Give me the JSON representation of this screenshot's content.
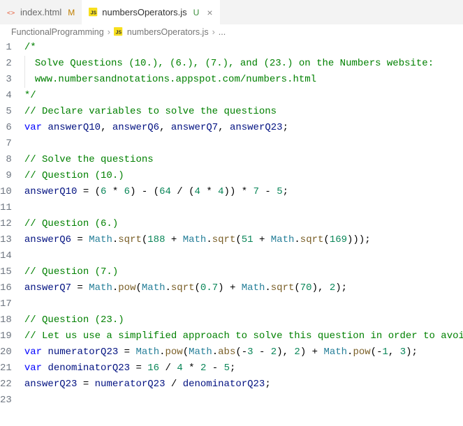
{
  "tabs": [
    {
      "label": "index.html",
      "status": "M",
      "icon": "html"
    },
    {
      "label": "numbersOperators.js",
      "status": "U",
      "icon": "js",
      "active": true
    }
  ],
  "breadcrumb": {
    "folder": "FunctionalProgramming",
    "file": "numbersOperators.js",
    "more": "..."
  },
  "code": {
    "lines": [
      {
        "n": 1,
        "segs": [
          {
            "t": "/*",
            "c": "c-comment"
          }
        ]
      },
      {
        "n": 2,
        "segs": [
          {
            "t": "    Solve Questions (10.), (6.), (7.), and (23.) on the Numbers website:",
            "c": "c-comment"
          }
        ],
        "guide": true
      },
      {
        "n": 3,
        "segs": [
          {
            "t": "    www.numbersandnotations.appspot.com/numbers.html",
            "c": "c-comment"
          }
        ],
        "guide": true
      },
      {
        "n": 4,
        "segs": [
          {
            "t": "*/",
            "c": "c-comment"
          }
        ]
      },
      {
        "n": 5,
        "segs": [
          {
            "t": "// Declare variables to solve the questions",
            "c": "c-comment"
          }
        ]
      },
      {
        "n": 6,
        "segs": [
          {
            "t": "var",
            "c": "c-keyword"
          },
          {
            "t": " "
          },
          {
            "t": "answerQ10",
            "c": "c-var"
          },
          {
            "t": ", "
          },
          {
            "t": "answerQ6",
            "c": "c-var"
          },
          {
            "t": ", "
          },
          {
            "t": "answerQ7",
            "c": "c-var"
          },
          {
            "t": ", "
          },
          {
            "t": "answerQ23",
            "c": "c-var"
          },
          {
            "t": ";"
          }
        ]
      },
      {
        "n": 7,
        "segs": []
      },
      {
        "n": 8,
        "segs": [
          {
            "t": "// Solve the questions",
            "c": "c-comment"
          }
        ]
      },
      {
        "n": 9,
        "segs": [
          {
            "t": "// Question (10.)",
            "c": "c-comment"
          }
        ]
      },
      {
        "n": 10,
        "segs": [
          {
            "t": "answerQ10",
            "c": "c-var"
          },
          {
            "t": " = ("
          },
          {
            "t": "6",
            "c": "c-num"
          },
          {
            "t": " * "
          },
          {
            "t": "6",
            "c": "c-num"
          },
          {
            "t": ") - ("
          },
          {
            "t": "64",
            "c": "c-num"
          },
          {
            "t": " / ("
          },
          {
            "t": "4",
            "c": "c-num"
          },
          {
            "t": " * "
          },
          {
            "t": "4",
            "c": "c-num"
          },
          {
            "t": ")) * "
          },
          {
            "t": "7",
            "c": "c-num"
          },
          {
            "t": " - "
          },
          {
            "t": "5",
            "c": "c-num"
          },
          {
            "t": ";"
          }
        ]
      },
      {
        "n": 11,
        "segs": []
      },
      {
        "n": 12,
        "segs": [
          {
            "t": "// Question (6.)",
            "c": "c-comment"
          }
        ]
      },
      {
        "n": 13,
        "segs": [
          {
            "t": "answerQ6",
            "c": "c-var"
          },
          {
            "t": " = "
          },
          {
            "t": "Math",
            "c": "c-obj"
          },
          {
            "t": "."
          },
          {
            "t": "sqrt",
            "c": "c-func"
          },
          {
            "t": "("
          },
          {
            "t": "188",
            "c": "c-num"
          },
          {
            "t": " + "
          },
          {
            "t": "Math",
            "c": "c-obj"
          },
          {
            "t": "."
          },
          {
            "t": "sqrt",
            "c": "c-func"
          },
          {
            "t": "("
          },
          {
            "t": "51",
            "c": "c-num"
          },
          {
            "t": " + "
          },
          {
            "t": "Math",
            "c": "c-obj"
          },
          {
            "t": "."
          },
          {
            "t": "sqrt",
            "c": "c-func"
          },
          {
            "t": "("
          },
          {
            "t": "169",
            "c": "c-num"
          },
          {
            "t": ")));"
          }
        ]
      },
      {
        "n": 14,
        "segs": []
      },
      {
        "n": 15,
        "segs": [
          {
            "t": "// Question (7.)",
            "c": "c-comment"
          }
        ]
      },
      {
        "n": 16,
        "segs": [
          {
            "t": "answerQ7",
            "c": "c-var"
          },
          {
            "t": " = "
          },
          {
            "t": "Math",
            "c": "c-obj"
          },
          {
            "t": "."
          },
          {
            "t": "pow",
            "c": "c-func"
          },
          {
            "t": "("
          },
          {
            "t": "Math",
            "c": "c-obj"
          },
          {
            "t": "."
          },
          {
            "t": "sqrt",
            "c": "c-func"
          },
          {
            "t": "("
          },
          {
            "t": "0.7",
            "c": "c-num"
          },
          {
            "t": ") + "
          },
          {
            "t": "Math",
            "c": "c-obj"
          },
          {
            "t": "."
          },
          {
            "t": "sqrt",
            "c": "c-func"
          },
          {
            "t": "("
          },
          {
            "t": "70",
            "c": "c-num"
          },
          {
            "t": "), "
          },
          {
            "t": "2",
            "c": "c-num"
          },
          {
            "t": ");"
          }
        ]
      },
      {
        "n": 17,
        "segs": []
      },
      {
        "n": 18,
        "segs": [
          {
            "t": "// Question (23.)",
            "c": "c-comment"
          }
        ]
      },
      {
        "n": 19,
        "segs": [
          {
            "t": "// Let us use a simplified approach to solve this question in order to avoid errors",
            "c": "c-comment"
          }
        ]
      },
      {
        "n": 20,
        "segs": [
          {
            "t": "var",
            "c": "c-keyword"
          },
          {
            "t": " "
          },
          {
            "t": "numeratorQ23",
            "c": "c-var"
          },
          {
            "t": " = "
          },
          {
            "t": "Math",
            "c": "c-obj"
          },
          {
            "t": "."
          },
          {
            "t": "pow",
            "c": "c-func"
          },
          {
            "t": "("
          },
          {
            "t": "Math",
            "c": "c-obj"
          },
          {
            "t": "."
          },
          {
            "t": "abs",
            "c": "c-func"
          },
          {
            "t": "(-"
          },
          {
            "t": "3",
            "c": "c-num"
          },
          {
            "t": " - "
          },
          {
            "t": "2",
            "c": "c-num"
          },
          {
            "t": "), "
          },
          {
            "t": "2",
            "c": "c-num"
          },
          {
            "t": ") + "
          },
          {
            "t": "Math",
            "c": "c-obj"
          },
          {
            "t": "."
          },
          {
            "t": "pow",
            "c": "c-func"
          },
          {
            "t": "(-"
          },
          {
            "t": "1",
            "c": "c-num"
          },
          {
            "t": ", "
          },
          {
            "t": "3",
            "c": "c-num"
          },
          {
            "t": ");"
          }
        ]
      },
      {
        "n": 21,
        "segs": [
          {
            "t": "var",
            "c": "c-keyword"
          },
          {
            "t": " "
          },
          {
            "t": "denominatorQ23",
            "c": "c-var"
          },
          {
            "t": " = "
          },
          {
            "t": "16",
            "c": "c-num"
          },
          {
            "t": " / "
          },
          {
            "t": "4",
            "c": "c-num"
          },
          {
            "t": " * "
          },
          {
            "t": "2",
            "c": "c-num"
          },
          {
            "t": " - "
          },
          {
            "t": "5",
            "c": "c-num"
          },
          {
            "t": ";"
          }
        ]
      },
      {
        "n": 22,
        "segs": [
          {
            "t": "answerQ23",
            "c": "c-var"
          },
          {
            "t": " = "
          },
          {
            "t": "numeratorQ23",
            "c": "c-var"
          },
          {
            "t": " / "
          },
          {
            "t": "denominatorQ23",
            "c": "c-var"
          },
          {
            "t": ";"
          }
        ]
      },
      {
        "n": 23,
        "segs": []
      }
    ]
  }
}
